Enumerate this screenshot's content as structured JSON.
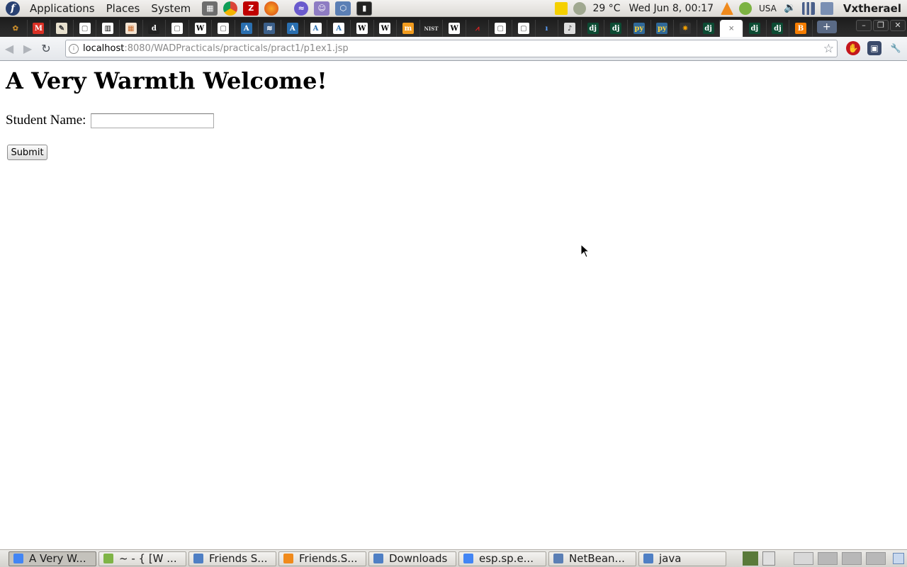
{
  "top_panel": {
    "menus": [
      "Applications",
      "Places",
      "System"
    ],
    "launchers": [
      "calculator-icon",
      "chrome-icon",
      "filezilla-icon",
      "firefox-icon",
      "emacs-icon",
      "pidgin-icon",
      "netbeans-icon",
      "terminal-icon"
    ],
    "weather": "29 °C",
    "clock": "Wed Jun  8, 00:17",
    "keyboard_layout": "USA",
    "username": "Vxtherael"
  },
  "browser": {
    "tab_favicons": [
      {
        "name": "tab-1",
        "glyph": "✿",
        "color": "#c58a2c",
        "bg": "transparent"
      },
      {
        "name": "tab-gmail",
        "glyph": "M",
        "color": "#ffffff",
        "bg": "#d93025"
      },
      {
        "name": "tab-3",
        "glyph": "✎",
        "color": "#333",
        "bg": "#e8e1cf"
      },
      {
        "name": "tab-4",
        "glyph": "▢",
        "color": "#555",
        "bg": "#ffffff"
      },
      {
        "name": "tab-5",
        "glyph": "▥",
        "color": "#000",
        "bg": "#ffffff"
      },
      {
        "name": "tab-6",
        "glyph": "▦",
        "color": "#c96a2a",
        "bg": "#f3e4d3"
      },
      {
        "name": "tab-dictionary",
        "glyph": "d",
        "color": "#ffffff",
        "bg": "#222222"
      },
      {
        "name": "tab-8",
        "glyph": "▢",
        "color": "#555",
        "bg": "#ffffff"
      },
      {
        "name": "tab-wikipedia-1",
        "glyph": "W",
        "color": "#000",
        "bg": "#ffffff"
      },
      {
        "name": "tab-10",
        "glyph": "▢",
        "color": "#555",
        "bg": "#ffffff"
      },
      {
        "name": "tab-11",
        "glyph": "A",
        "color": "#ffffff",
        "bg": "#2a6fb0"
      },
      {
        "name": "tab-12",
        "glyph": "≋",
        "color": "#ffffff",
        "bg": "#3b5f8a"
      },
      {
        "name": "tab-13",
        "glyph": "A",
        "color": "#ffffff",
        "bg": "#2a6fb0"
      },
      {
        "name": "tab-14",
        "glyph": "A",
        "color": "#2a6fb0",
        "bg": "#ffffff"
      },
      {
        "name": "tab-15",
        "glyph": "A",
        "color": "#2a6fb0",
        "bg": "#ffffff"
      },
      {
        "name": "tab-wikipedia-2",
        "glyph": "W",
        "color": "#000",
        "bg": "#ffffff"
      },
      {
        "name": "tab-wikipedia-3",
        "glyph": "W",
        "color": "#000",
        "bg": "#ffffff"
      },
      {
        "name": "tab-18",
        "glyph": "m",
        "color": "#ffffff",
        "bg": "#f29c1f"
      },
      {
        "name": "tab-nist",
        "glyph": "NIST",
        "color": "#ddd",
        "bg": "transparent"
      },
      {
        "name": "tab-wikipedia-4",
        "glyph": "W",
        "color": "#000",
        "bg": "#ffffff"
      },
      {
        "name": "tab-21",
        "glyph": "⩘",
        "color": "#d22",
        "bg": "transparent"
      },
      {
        "name": "tab-22",
        "glyph": "▢",
        "color": "#555",
        "bg": "#ffffff"
      },
      {
        "name": "tab-23",
        "glyph": "▢",
        "color": "#555",
        "bg": "#ffffff"
      },
      {
        "name": "tab-24",
        "glyph": "ı",
        "color": "#5aa0ff",
        "bg": "transparent"
      },
      {
        "name": "tab-25",
        "glyph": "♪",
        "color": "#333",
        "bg": "#dddddd"
      },
      {
        "name": "tab-django-1",
        "glyph": "dj",
        "color": "#ffffff",
        "bg": "#0c4b33"
      },
      {
        "name": "tab-django-2",
        "glyph": "dj",
        "color": "#ffffff",
        "bg": "#0c4b33"
      },
      {
        "name": "tab-python-1",
        "glyph": "py",
        "color": "#ffd43b",
        "bg": "#306998"
      },
      {
        "name": "tab-python-2",
        "glyph": "py",
        "color": "#ffd43b",
        "bg": "#306998"
      },
      {
        "name": "tab-30",
        "glyph": "✷",
        "color": "#f4a000",
        "bg": "#333"
      },
      {
        "name": "tab-django-3",
        "glyph": "dj",
        "color": "#ffffff",
        "bg": "#0c4b33"
      },
      {
        "name": "tab-active",
        "glyph": "×",
        "color": "#888",
        "bg": "transparent"
      },
      {
        "name": "tab-django-4",
        "glyph": "dj",
        "color": "#ffffff",
        "bg": "#0c4b33"
      },
      {
        "name": "tab-django-5",
        "glyph": "dj",
        "color": "#ffffff",
        "bg": "#0c4b33"
      },
      {
        "name": "tab-blogger",
        "glyph": "B",
        "color": "#ffffff",
        "bg": "#f57d00"
      }
    ],
    "new_tab": "+",
    "url_host": "localhost",
    "url_rest": ":8080/WADPracticals/practicals/pract1/p1ex1.jsp"
  },
  "page": {
    "heading": "A Very Warmth Welcome!",
    "student_label": "Student Name:",
    "student_value": "",
    "submit_label": "Submit"
  },
  "taskbar": {
    "items": [
      {
        "label": "A Very W...",
        "icon_color": "#4285f4",
        "active": true
      },
      {
        "label": "~ - { [W ...",
        "icon_color": "#7fb447",
        "active": false
      },
      {
        "label": "Friends S...",
        "icon_color": "#4f7fc4",
        "active": false
      },
      {
        "label": "Friends.S...",
        "icon_color": "#f08a1c",
        "active": false
      },
      {
        "label": "Downloads",
        "icon_color": "#4f7fc4",
        "active": false
      },
      {
        "label": "esp.sp.e...",
        "icon_color": "#4285f4",
        "active": false
      },
      {
        "label": "NetBean...",
        "icon_color": "#5b7fb5",
        "active": false
      },
      {
        "label": "java",
        "icon_color": "#4f7fc4",
        "active": false
      }
    ]
  }
}
